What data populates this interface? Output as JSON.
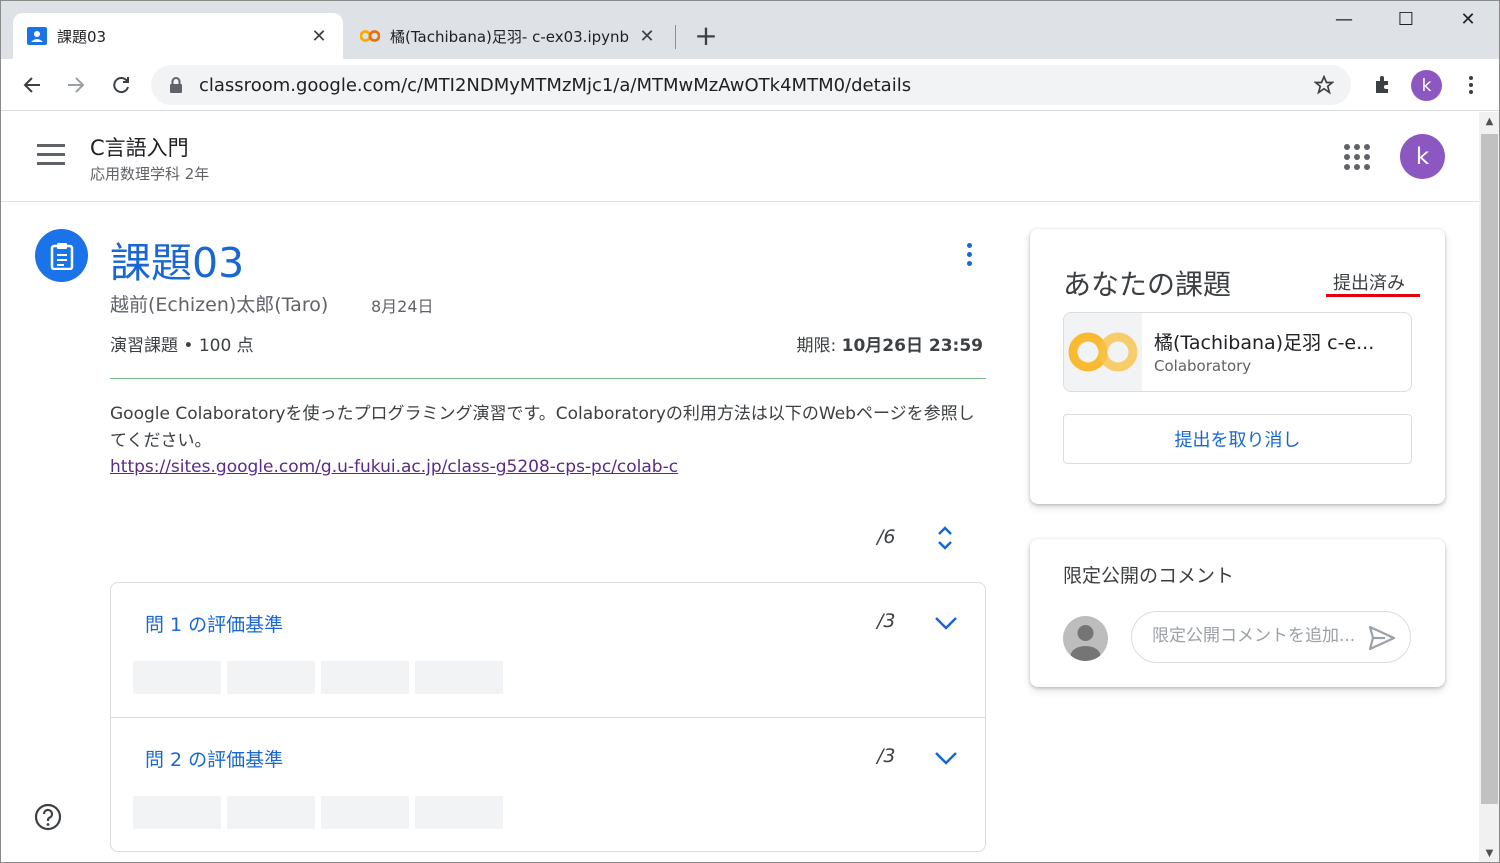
{
  "browser": {
    "tabs": [
      {
        "title": "課題03",
        "active": true
      },
      {
        "title": "橘(Tachibana)足羽- c-ex03.ipynb",
        "active": false
      }
    ],
    "url": "classroom.google.com/c/MTI2NDMyMTMzMjc1/a/MTMwMzAwOTk4MTM0/details",
    "profile_initial": "k"
  },
  "header": {
    "course_title": "C言語入門",
    "course_subtitle": "応用数理学科 2年",
    "profile_initial": "k"
  },
  "assignment": {
    "title": "課題03",
    "author": "越前(Echizen)太郎(Taro)",
    "posted_date": "8月24日",
    "meta": "演習課題 • 100 点",
    "due_label": "期限: ",
    "due_value": "10月26日 23:59",
    "description": "Google Colaboratoryを使ったプログラミング演習です。Colaboratoryの利用方法は以下のWebページを参照してください。",
    "link": "https://sites.google.com/g.u-fukui.ac.jp/class-g5208-cps-pc/colab-c"
  },
  "rubric": {
    "total": "/6",
    "criteria": [
      {
        "title": "問 1 の評価基準",
        "score": "/3"
      },
      {
        "title": "問 2 の評価基準",
        "score": "/3"
      }
    ]
  },
  "your_work": {
    "title": "あなたの課題",
    "status": "提出済み",
    "attachment_name": "橘(Tachibana)足羽 c-e...",
    "attachment_type": "Colaboratory",
    "unsubmit_label": "提出を取り消し"
  },
  "private_comments": {
    "title": "限定公開のコメント",
    "placeholder": "限定公開コメントを追加..."
  },
  "colors": {
    "accent": "#1967d2",
    "status_underline": "#e3000f",
    "avatar": "#8d57c2"
  }
}
